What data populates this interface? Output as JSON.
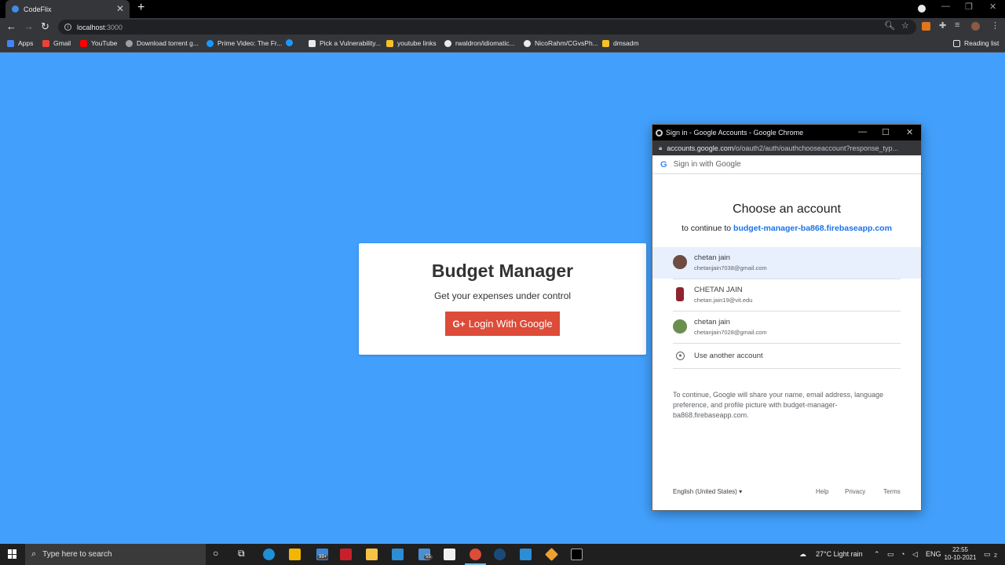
{
  "browser": {
    "tab_title": "CodeFlix",
    "url_host": "localhost",
    "url_port": ":3000",
    "bookmarks": [
      {
        "label": "Apps",
        "icon": "apps-grid-icon",
        "color": "#4285f4"
      },
      {
        "label": "Gmail",
        "icon": "gmail-icon",
        "color": "#ea4335"
      },
      {
        "label": "YouTube",
        "icon": "youtube-icon",
        "color": "#ff0000"
      },
      {
        "label": "Download torrent g...",
        "icon": "torrent-site-icon",
        "color": "#9aa0a6"
      },
      {
        "label": "Prime Video: The Fr...",
        "icon": "prime-video-icon",
        "color": "#1a98ff"
      },
      {
        "label": "",
        "icon": "prime-video-icon",
        "color": "#1a98ff"
      },
      {
        "label": "Pick a Vulnerability...",
        "icon": "vulnerability-site-icon",
        "color": "#e8eaed"
      },
      {
        "label": "youtube links",
        "icon": "folder-icon",
        "color": "#f6c026"
      },
      {
        "label": "rwaldron/idiomatic...",
        "icon": "github-icon",
        "color": "#e8eaed"
      },
      {
        "label": "NicoRahm/CGvsPh...",
        "icon": "github-icon",
        "color": "#e8eaed"
      },
      {
        "label": "dmsadm",
        "icon": "folder-icon",
        "color": "#f6c026"
      }
    ],
    "reading_list": "Reading list"
  },
  "app": {
    "title": "Budget Manager",
    "subtitle": "Get your expenses under control",
    "login_button": "Login With Google",
    "login_button_color": "#dd4b39",
    "background_color": "#42a0fc"
  },
  "popup": {
    "window_title": "Sign in - Google Accounts - Google Chrome",
    "url_domain": "accounts.google.com",
    "url_path": "/o/oauth2/auth/oauthchooseaccount?response_typ...",
    "signin_label": "Sign in with Google",
    "heading": "Choose an account",
    "continue_prefix": "to continue to",
    "continue_app": "budget-manager-ba868.firebaseapp.com",
    "accounts": [
      {
        "name": "chetan jain",
        "email": "chetanjain7038@gmail.com",
        "avatar_color": "#6d4c41"
      },
      {
        "name": "CHETAN JAIN",
        "email": "chetan.jain19@vit.edu",
        "avatar_color": "#8e2430"
      },
      {
        "name": "chetan jain",
        "email": "chetanjain7028@gmail.com",
        "avatar_color": "#6b8e4e"
      }
    ],
    "use_another": "Use another account",
    "disclaimer": "To continue, Google will share your name, email address, language preference, and profile picture with budget-manager-ba868.firebaseapp.com.",
    "language": "English (United States)",
    "footer_links": [
      "Help",
      "Privacy",
      "Terms"
    ]
  },
  "taskbar": {
    "search_placeholder": "Type here to search",
    "mail_badge": "99+",
    "app_badge": "55",
    "weather": "27°C  Light rain",
    "language": "ENG",
    "time": "22:55",
    "date": "10-10-2021",
    "notification_count": "2"
  }
}
